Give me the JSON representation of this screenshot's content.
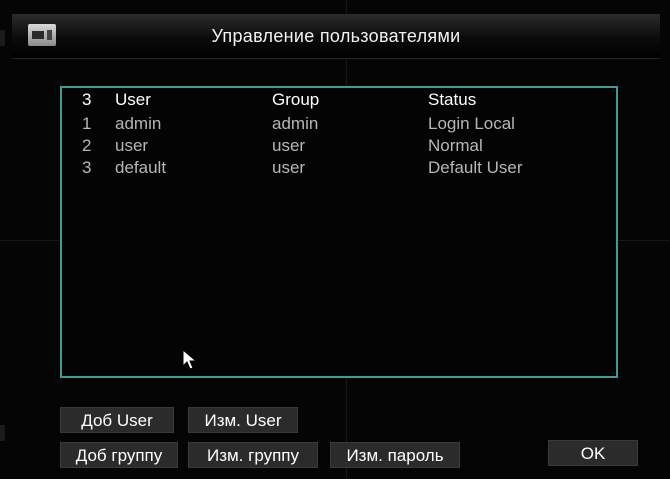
{
  "window": {
    "title": "Управление пользователями",
    "icon": "window-icon"
  },
  "list": {
    "header": {
      "count": "3",
      "user": "User",
      "group": "Group",
      "status": "Status"
    },
    "rows": [
      {
        "num": "1",
        "user": "admin",
        "group": "admin",
        "status": "Login Local"
      },
      {
        "num": "2",
        "user": "user",
        "group": "user",
        "status": "Normal"
      },
      {
        "num": "3",
        "user": "default",
        "group": "user",
        "status": "Default User"
      }
    ]
  },
  "buttons": {
    "add_user": "Доб User",
    "edit_user": "Изм. User",
    "add_group": "Доб группу",
    "edit_group": "Изм. группу",
    "change_password": "Изм. пароль",
    "ok": "OK"
  },
  "colors": {
    "list_border": "#3d9c9a",
    "text_header": "#ffffff",
    "text_item": "#b7b7b7"
  }
}
